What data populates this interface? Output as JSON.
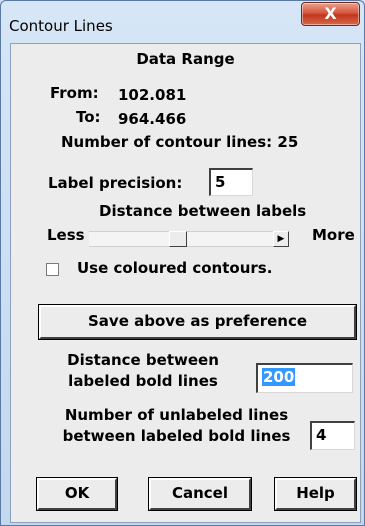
{
  "window": {
    "title": "Contour Lines",
    "close_glyph": "X"
  },
  "data_range": {
    "heading": "Data Range",
    "from_label": "From:",
    "from_value": "102.081",
    "to_label": "To:",
    "to_value": "964.466",
    "count_text": "Number of contour lines: 25"
  },
  "label_precision": {
    "label": "Label precision:",
    "value": "5"
  },
  "label_distance": {
    "heading": "Distance between labels",
    "less_label": "Less",
    "more_label": "More",
    "slider_level": 0.48
  },
  "coloured": {
    "label": "Use coloured contours.",
    "checked": false
  },
  "save_button": "Save above as preference",
  "bold_distance": {
    "line1": "Distance between",
    "line2": "labeled bold lines",
    "value": "200"
  },
  "unlabeled": {
    "line1": "Number of unlabeled lines",
    "line2": "between labeled bold lines",
    "value": "4"
  },
  "buttons": {
    "ok": "OK",
    "cancel": "Cancel",
    "help": "Help"
  }
}
